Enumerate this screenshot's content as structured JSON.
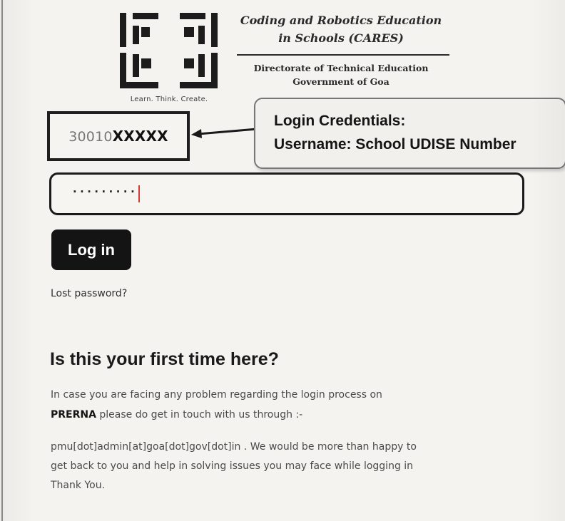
{
  "header": {
    "logo_tagline": "Learn. Think. Create.",
    "title_line1": "Coding and Robotics Education",
    "title_line2": "in Schools (CARES)",
    "subtitle_line1": "Directorate of Technical Education",
    "subtitle_line2": "Government of Goa"
  },
  "login_form": {
    "username_prefix": "30010",
    "username_masked": "XXXXX",
    "password_dots": "·········",
    "login_label": "Log in",
    "lost_password_label": "Lost password?"
  },
  "callout": {
    "line1": "Login Credentials:",
    "line2": "Username: School UDISE Number"
  },
  "first_time": {
    "heading": "Is this your first time here?",
    "line1": "In case you are facing any problem regarding the login process on",
    "brand": "PRERNA",
    "line2_rest": " please do get in touch with us through :-",
    "line3": "pmu[dot]admin[at]goa[dot]gov[dot]in . We would be more than happy to",
    "line4": "get back to you and help in solving issues you may face while logging in",
    "line5": "Thank You."
  },
  "colors": {
    "background": "#f4f3f0",
    "button": "#141414",
    "caret": "#d43a3a"
  }
}
